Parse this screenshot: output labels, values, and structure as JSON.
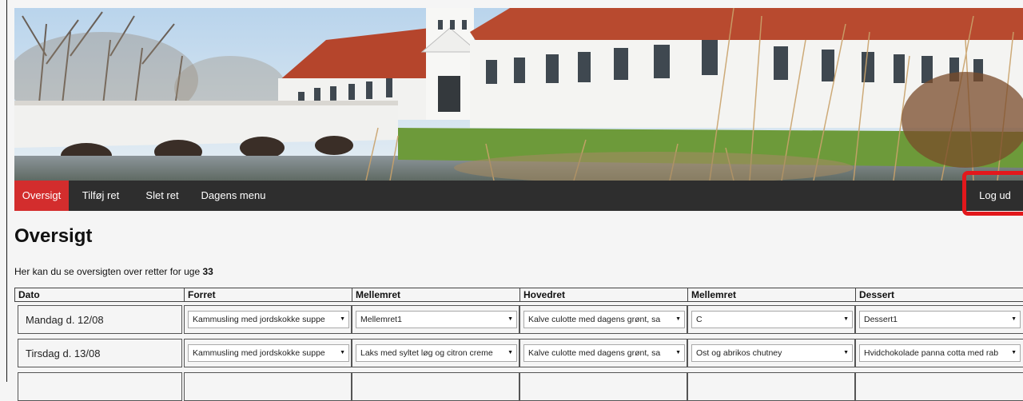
{
  "nav": {
    "items": [
      {
        "label": "Oversigt",
        "active": true
      },
      {
        "label": "Tilføj ret",
        "active": false
      },
      {
        "label": "Slet ret",
        "active": false
      },
      {
        "label": "Dagens menu",
        "active": false
      }
    ],
    "logout_label": "Log ud"
  },
  "page": {
    "title": "Oversigt",
    "intro_prefix": "Her kan du se oversigten over retter for uge ",
    "week": "33"
  },
  "table": {
    "headers": [
      "Dato",
      "Forret",
      "Mellemret",
      "Hovedret",
      "Mellemret",
      "Dessert"
    ],
    "rows": [
      {
        "date": "Mandag d. 12/08",
        "selections": [
          "Kammusling med jordskokke suppe",
          "Mellemret1",
          "Kalve culotte med dagens grønt, sa",
          "C",
          "Dessert1"
        ]
      },
      {
        "date": "Tirsdag d. 13/08",
        "selections": [
          "Kammusling med jordskokke suppe",
          "Laks med syltet løg og citron creme",
          "Kalve culotte med dagens grønt, sa",
          "Ost og abrikos chutney",
          "Hvidchokolade panna cotta med rab"
        ]
      },
      {
        "date": "",
        "selections": [
          "",
          "",
          "",
          "",
          ""
        ]
      }
    ]
  },
  "colors": {
    "nav_bg": "#2e2e2e",
    "nav_active": "#d32d2d",
    "highlight": "#e2181c",
    "page_bg": "#f5f5f5"
  }
}
